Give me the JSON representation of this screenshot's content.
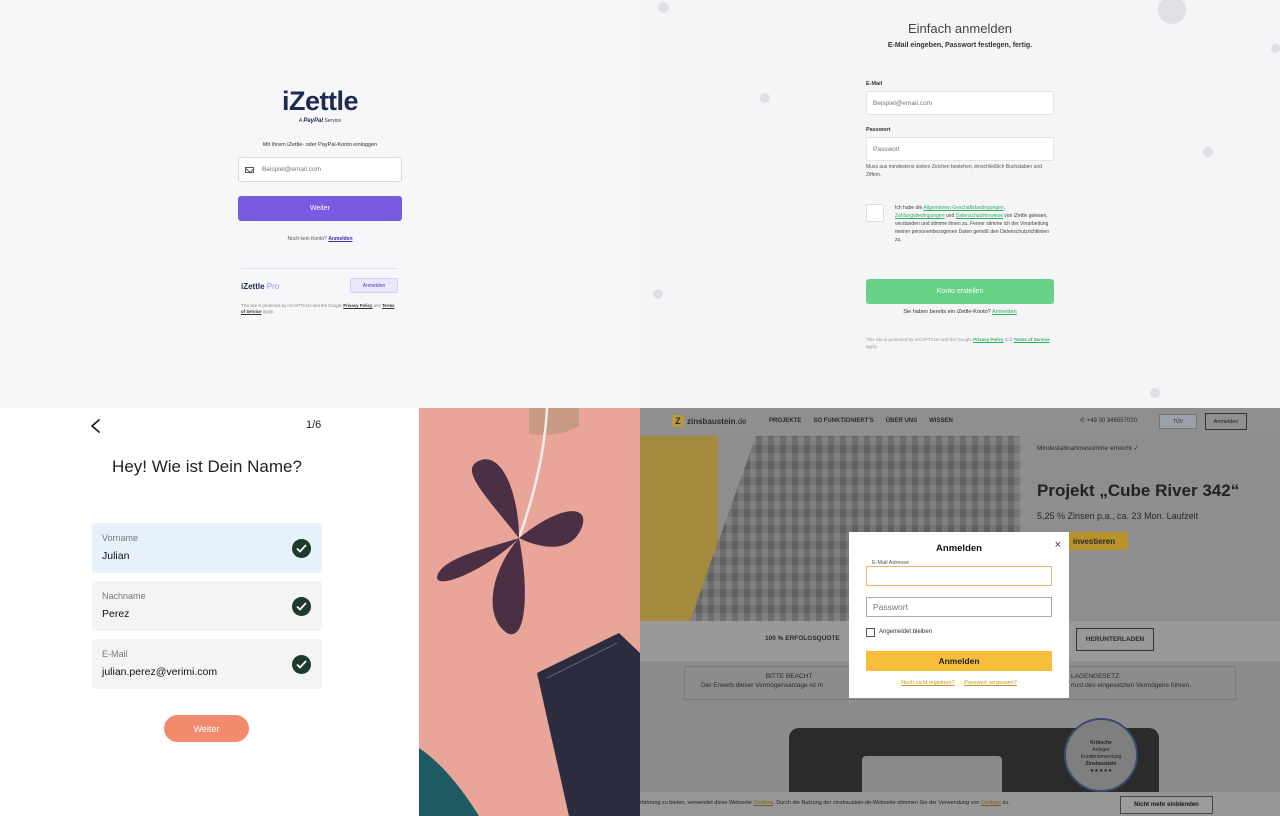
{
  "izettle": {
    "logo": "iZettle",
    "subtitle_prefix": "A",
    "subtitle_brand": "PayPal",
    "subtitle_suffix": "Service",
    "hint": "Mit Ihrem iZettle- oder PayPal-Konto einloggen",
    "email_placeholder": "Beispiel@email.com",
    "continue_label": "Weiter",
    "no_account_text": "Noch kein Konto?",
    "register_link": "Anmelden",
    "pro_logo": "iZettle",
    "pro_suffix": "Pro",
    "pro_login_label": "Anmelden",
    "legal_prefix": "This site is protected by reCAPTCHA and the Google",
    "legal_privacy": "Privacy Policy",
    "legal_and": "and",
    "legal_terms": "Terms of Service",
    "legal_suffix": "apply.",
    "accent": "#7a5ae0"
  },
  "register": {
    "title": "Einfach anmelden",
    "subtitle": "E-Mail eingeben, Passwort festlegen, fertig.",
    "email_label": "E-Mail",
    "email_placeholder": "Beispiel@email.com",
    "password_label": "Passwort",
    "password_placeholder": "Passwort",
    "password_hint": "Muss aus mindestens sieben Zeichen bestehen, einschließlich Buchstaben und Ziffern.",
    "terms_1": "Ich habe die",
    "terms_link_1": "Allgemeinen Geschäftsbedingungen",
    "terms_2": ",",
    "terms_link_2": "Zahlungsbedingungen",
    "terms_3": "und",
    "terms_link_3": "Datenschutzhinweise",
    "terms_4": "von iZettle gelesen, verstanden und stimme ihnen zu. Ferner stimme ich der Verarbeitung meiner personenbezogenen Daten gemäß den Datenschutzrichtlinien zu.",
    "create_label": "Konto erstellen",
    "have_account": "Sie haben bereits ein iZettle-Konto?",
    "login_link": "Anmelden",
    "legal_prefix": "This site is protected by reCAPTCHA and the Google",
    "legal_privacy": "Privacy Policy",
    "legal_and": "and",
    "legal_terms": "Terms of Service",
    "legal_suffix": "apply.",
    "accent": "#67d285"
  },
  "verimi": {
    "step": "1/6",
    "title": "Hey! Wie ist Dein Name?",
    "fields": [
      {
        "label": "Vorname",
        "value": "Julian"
      },
      {
        "label": "Nachname",
        "value": "Perez"
      },
      {
        "label": "E-Mail",
        "value": "julian.perez@verimi.com"
      }
    ],
    "continue_label": "Weiter",
    "accent": "#f28b6d"
  },
  "zins": {
    "brand": "zinsbaustein",
    "brand_tld": ".de",
    "brand_initial": "Z",
    "menu": [
      "PROJEKTE",
      "SO FUNKTIONIERT'S",
      "ÜBER UNS",
      "WISSEN"
    ],
    "phone": "+49 30 346557030",
    "tuv": "TÜV",
    "top_login": "Anmelden",
    "min_reached": "Mindestabnahmesumme erreicht ✓",
    "project_title": "Projekt „Cube River 342“",
    "interest": "5,25 % Zinsen p.a., ca. 23 Mon. Laufzeit",
    "invest_label": "investieren",
    "success": "100 % ERFOLGSQUOTE",
    "download_label": "HERUNTERLADEN",
    "warn_left_1": "BITTE BEACHT",
    "warn_left_2": "Der Erwerb dieser Vermögensanlage ist m",
    "warn_right_1": "LAGENGESETZ:",
    "warn_right_2": "rlust des eingesetzten Vermögens führen.",
    "seal_1": "Kritische",
    "seal_2": "Anleger",
    "seal_3": "Kundenbewertung",
    "seal_4": "Zinsbaustein",
    "seal_stars": "★★★★★",
    "cookie_1": "rfahrung zu bieten, verwendet diese Webseite",
    "cookie_link_1": "Cookies",
    "cookie_2": ". Durch die Nutzung der zinsbaustein.de-Webseite stimmen Sie der Verwendung von",
    "cookie_link_2": "Cookies",
    "cookie_3": "zu.",
    "cookie_button": "Nicht mehr einblenden",
    "modal": {
      "title": "Anmelden",
      "close": "×",
      "email_label": "E-Mail Adresse",
      "password_placeholder": "Passwort",
      "remember": "Angemeldet bleiben",
      "submit": "Anmelden",
      "link_register": "Noch nicht registriert?",
      "link_forgot": "Passwort vergessen?"
    },
    "accent": "#f6be3b"
  }
}
